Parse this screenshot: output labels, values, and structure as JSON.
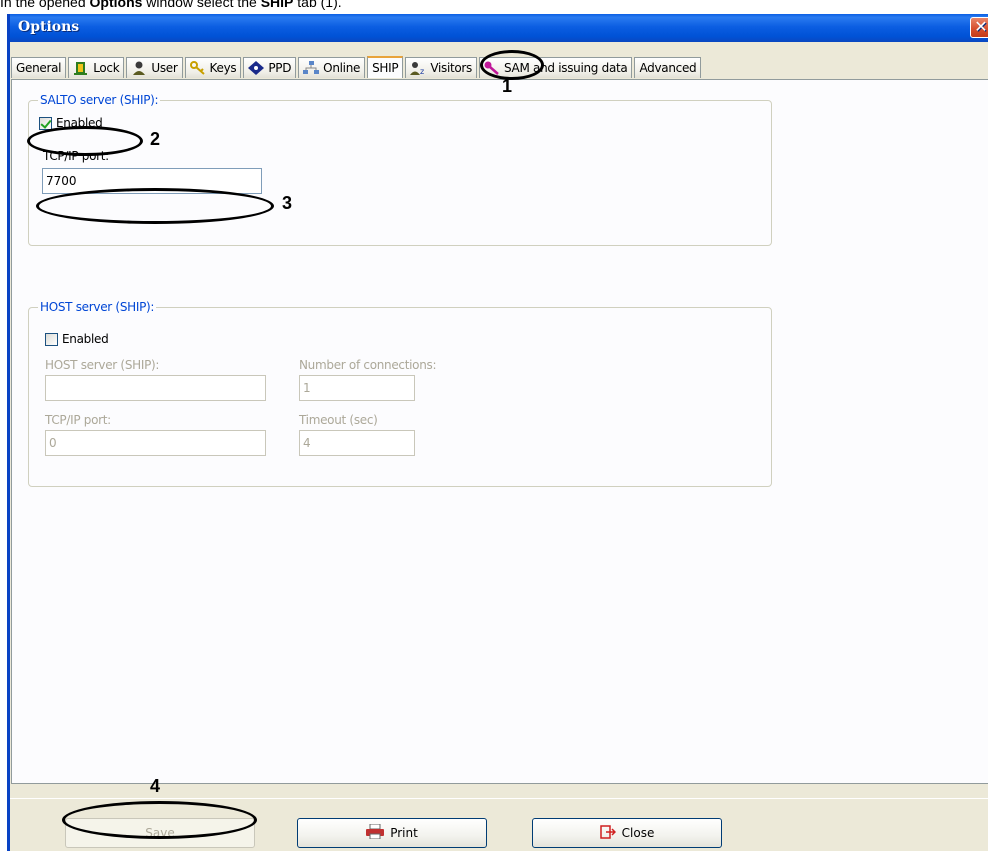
{
  "caption": {
    "prefix": "In the opened ",
    "bold1": "Options",
    "middle": " window select the ",
    "bold2": "SHIP",
    "suffix": " tab (1)."
  },
  "window": {
    "title": "Options",
    "close_glyph": "✕"
  },
  "tabs": [
    {
      "label": "General",
      "icon": ""
    },
    {
      "label": "Lock",
      "icon": "lock-icon"
    },
    {
      "label": "User",
      "icon": "user-icon"
    },
    {
      "label": "Keys",
      "icon": "keys-icon"
    },
    {
      "label": "PPD",
      "icon": "ppd-icon"
    },
    {
      "label": "Online",
      "icon": "network-icon"
    },
    {
      "label": "SHIP",
      "icon": "",
      "active": true
    },
    {
      "label": "Visitors",
      "icon": "visitors-icon"
    },
    {
      "label": "SAM and issuing data",
      "icon": "key-icon"
    },
    {
      "label": "Advanced",
      "icon": ""
    }
  ],
  "salto": {
    "legend": "SALTO server (SHIP):",
    "enabled_label": "Enabled",
    "enabled": true,
    "port_label": "TCP/IP port:",
    "port_value": "7700"
  },
  "host": {
    "legend": "HOST server (SHIP):",
    "enabled_label": "Enabled",
    "enabled": false,
    "server_label": "HOST server (SHIP):",
    "server_value": "",
    "connections_label": "Number of connections:",
    "connections_value": "1",
    "port_label": "TCP/IP port:",
    "port_value": "0",
    "timeout_label": "Timeout (sec)",
    "timeout_value": "4"
  },
  "buttons": {
    "save": "Save",
    "print": "Print",
    "close": "Close"
  },
  "annotations": {
    "n1": "1",
    "n2": "2",
    "n3": "3",
    "n4": "4"
  },
  "colors": {
    "titlebar": "#0a5fe4",
    "legend": "#0046d5",
    "disabled_text": "#aca899"
  }
}
